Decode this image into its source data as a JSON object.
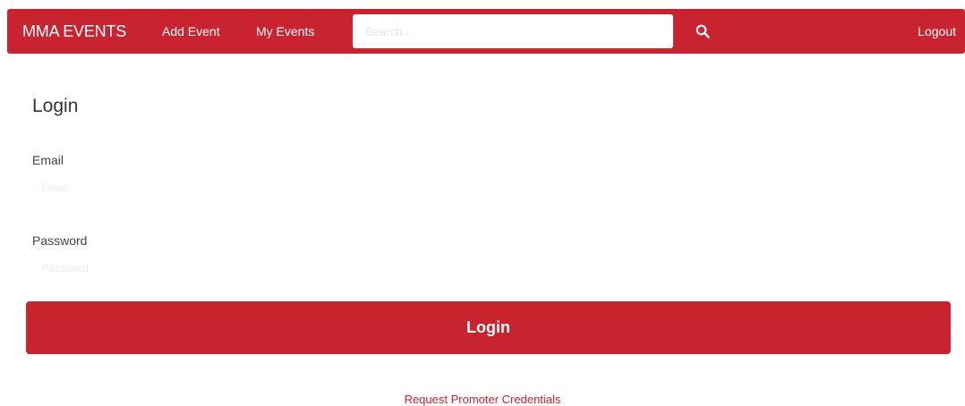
{
  "navbar": {
    "brand": "MMA EVENTS",
    "add_event": "Add Event",
    "my_events": "My Events",
    "search_placeholder": "Search...",
    "logout": "Logout",
    "search_icon": "search-icon"
  },
  "colors": {
    "brand": "#c8232f",
    "text": "#333333",
    "background": "#ffffff"
  },
  "login": {
    "title": "Login",
    "email_label": "Email",
    "email_placeholder": "Email",
    "password_label": "Password",
    "password_placeholder": "Password",
    "submit_label": "Login",
    "request_link": "Request Promoter Credentials"
  }
}
